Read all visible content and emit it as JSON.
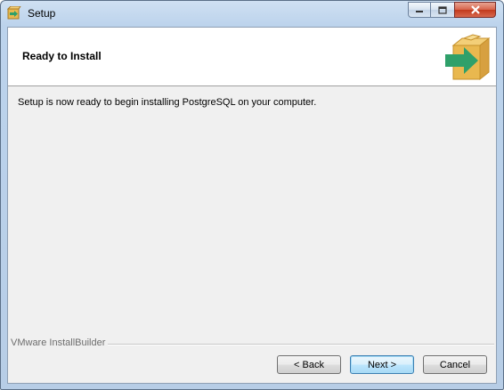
{
  "window": {
    "title": "Setup",
    "controls": {
      "minimize": "minimize-icon",
      "maximize": "maximize-icon",
      "close": "close-icon"
    }
  },
  "header": {
    "title": "Ready to Install",
    "icon": "installer-box-arrow-icon"
  },
  "body": {
    "message": "Setup is now ready to begin installing PostgreSQL on your computer."
  },
  "footer": {
    "brand": "VMware InstallBuilder",
    "buttons": {
      "back": "< Back",
      "next": "Next >",
      "cancel": "Cancel"
    }
  },
  "colors": {
    "title_bar": "#bcd3ec",
    "close_button": "#c2391c",
    "client_bg": "#f0f0f0",
    "header_bg": "#ffffff",
    "box_icon": "#e9b84f",
    "arrow_icon": "#2fa06a",
    "default_button": "#3c7fb1"
  }
}
